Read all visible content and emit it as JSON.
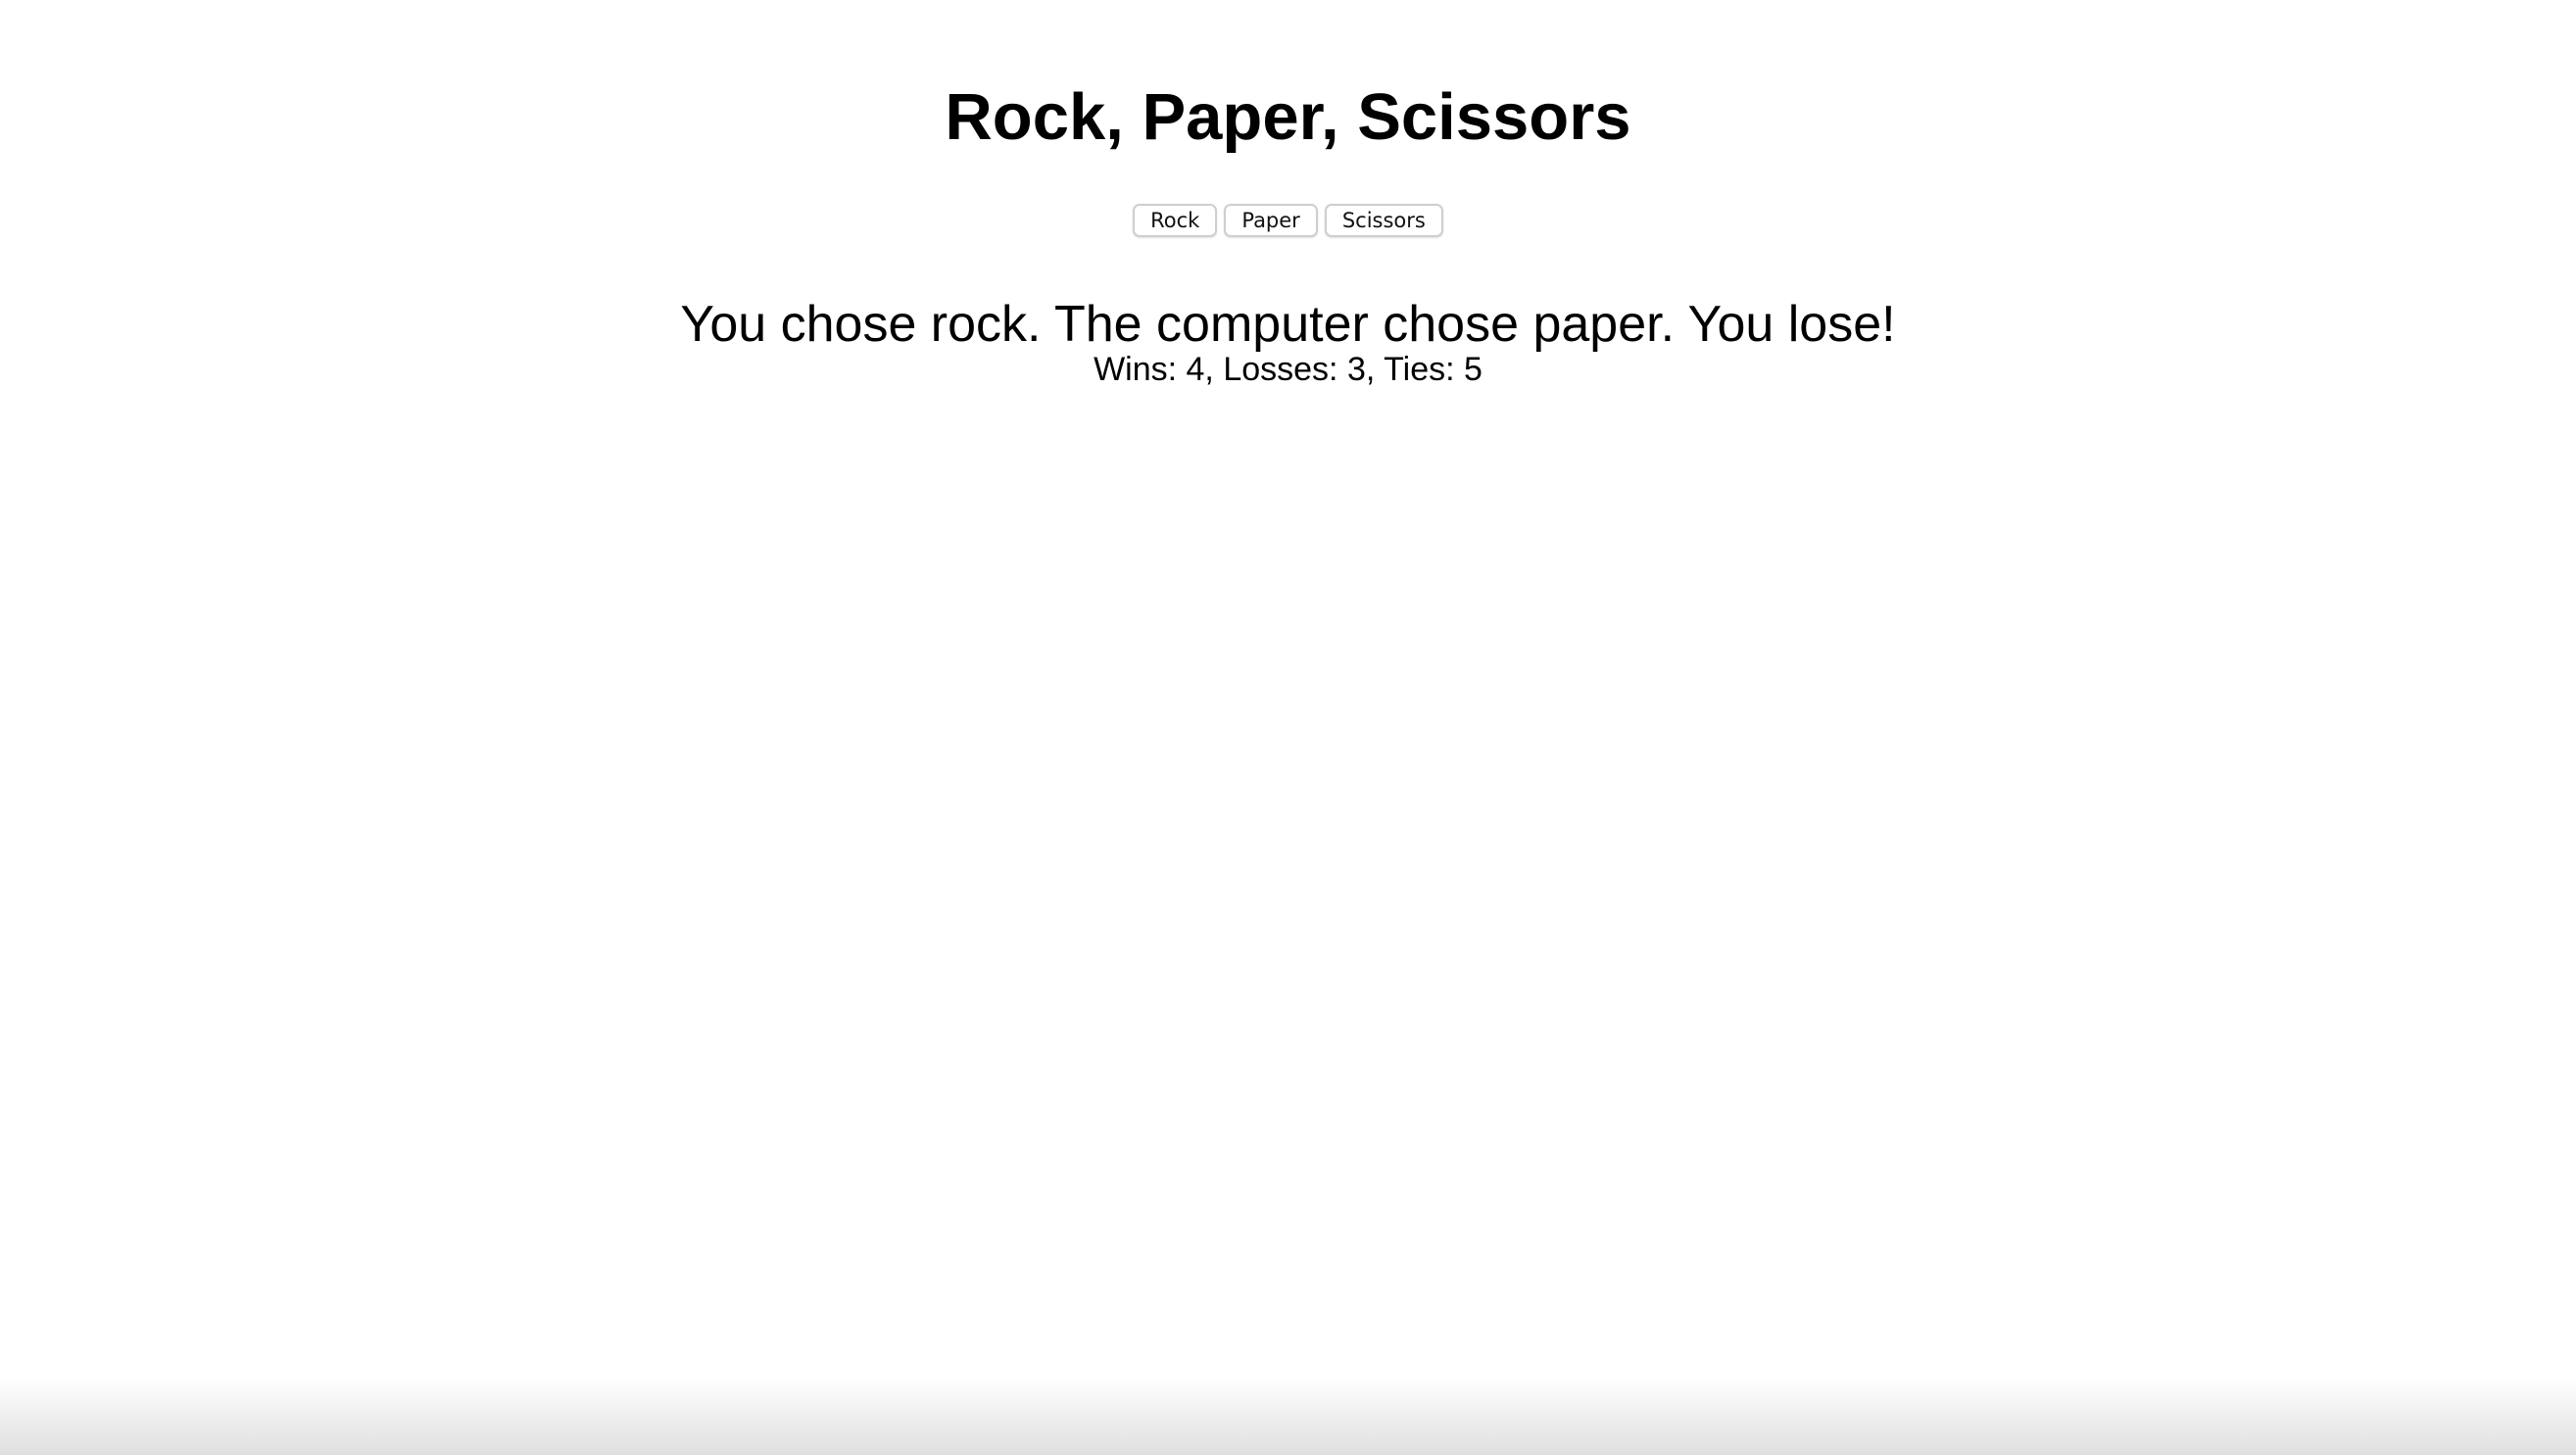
{
  "page": {
    "title": "Rock, Paper, Scissors"
  },
  "controls": {
    "buttons": [
      {
        "label": "Rock"
      },
      {
        "label": "Paper"
      },
      {
        "label": "Scissors"
      }
    ]
  },
  "status": {
    "result_message": "You chose rock. The computer chose paper. You lose!",
    "score_text": "Wins: 4, Losses: 3, Ties: 5"
  }
}
